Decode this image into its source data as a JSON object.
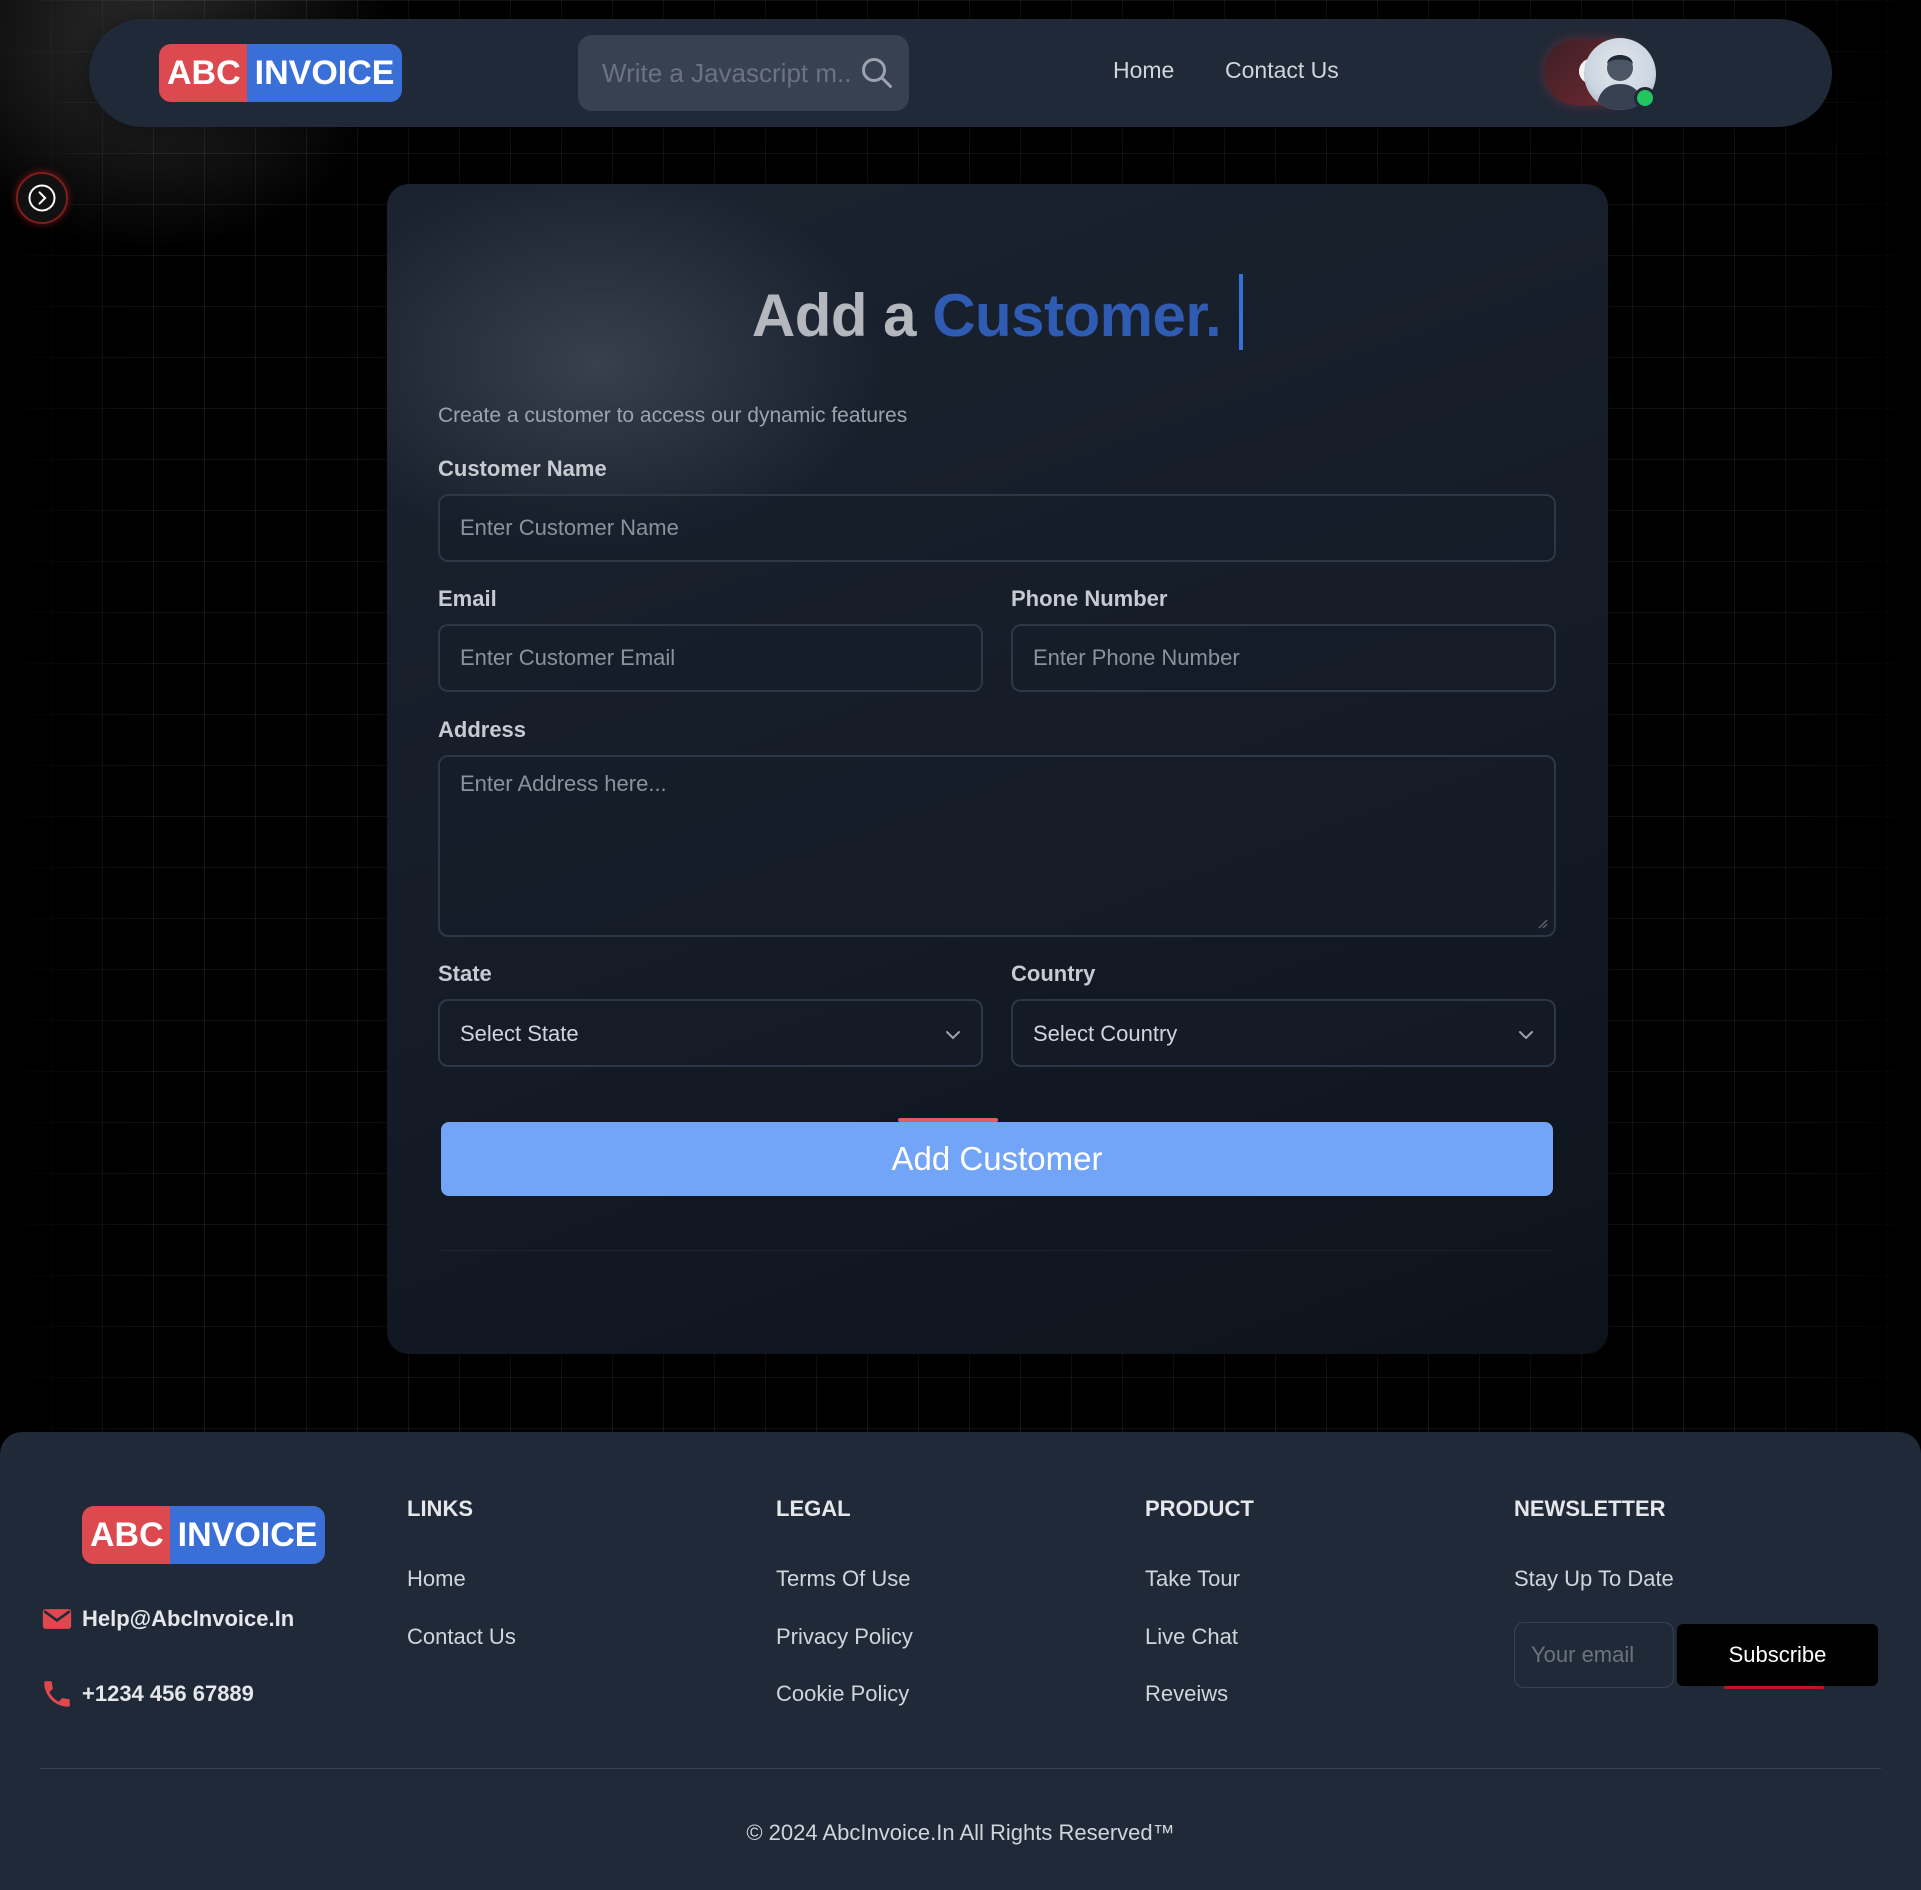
{
  "brand": {
    "logo_part1": "ABC",
    "logo_part2": "INVOICE",
    "red": "#dc4a50",
    "blue": "#3b6fd8"
  },
  "navbar": {
    "search_placeholder": "Write a Javascript m...",
    "links": [
      "Home",
      "Contact Us"
    ],
    "theme_icon": "moon-icon",
    "avatar_icon": "user-avatar",
    "status": "online"
  },
  "sidebar_toggle_icon": "chevron-right-circle-icon",
  "form": {
    "title_prefix": "Add a",
    "title_accent": "Customer.",
    "subtitle": "Create a customer to access our dynamic features",
    "customer_name": {
      "label": "Customer Name",
      "placeholder": "Enter Customer Name"
    },
    "email": {
      "label": "Email",
      "placeholder": "Enter Customer Email"
    },
    "phone": {
      "label": "Phone Number",
      "placeholder": "Enter Phone Number"
    },
    "address": {
      "label": "Address",
      "placeholder": "Enter Address here..."
    },
    "state": {
      "label": "State",
      "value": "Select State"
    },
    "country": {
      "label": "Country",
      "value": "Select Country"
    },
    "submit_label": "Add Customer",
    "accent_color": "#72a5f8"
  },
  "footer": {
    "email": "Help@AbcInvoice.In",
    "phone": "+1234 456 67889",
    "columns": [
      {
        "heading": "LINKS",
        "items": [
          "Home",
          "Contact Us"
        ]
      },
      {
        "heading": "LEGAL",
        "items": [
          "Terms Of Use",
          "Privacy Policy",
          "Cookie Policy"
        ]
      },
      {
        "heading": "PRODUCT",
        "items": [
          "Take Tour",
          "Live Chat",
          "Reveiws"
        ]
      }
    ],
    "newsletter": {
      "heading": "NEWSLETTER",
      "text": "Stay Up To Date",
      "placeholder": "Your email",
      "button": "Subscribe"
    },
    "copyright": "© 2024 AbcInvoice.In All Rights Reserved™"
  }
}
